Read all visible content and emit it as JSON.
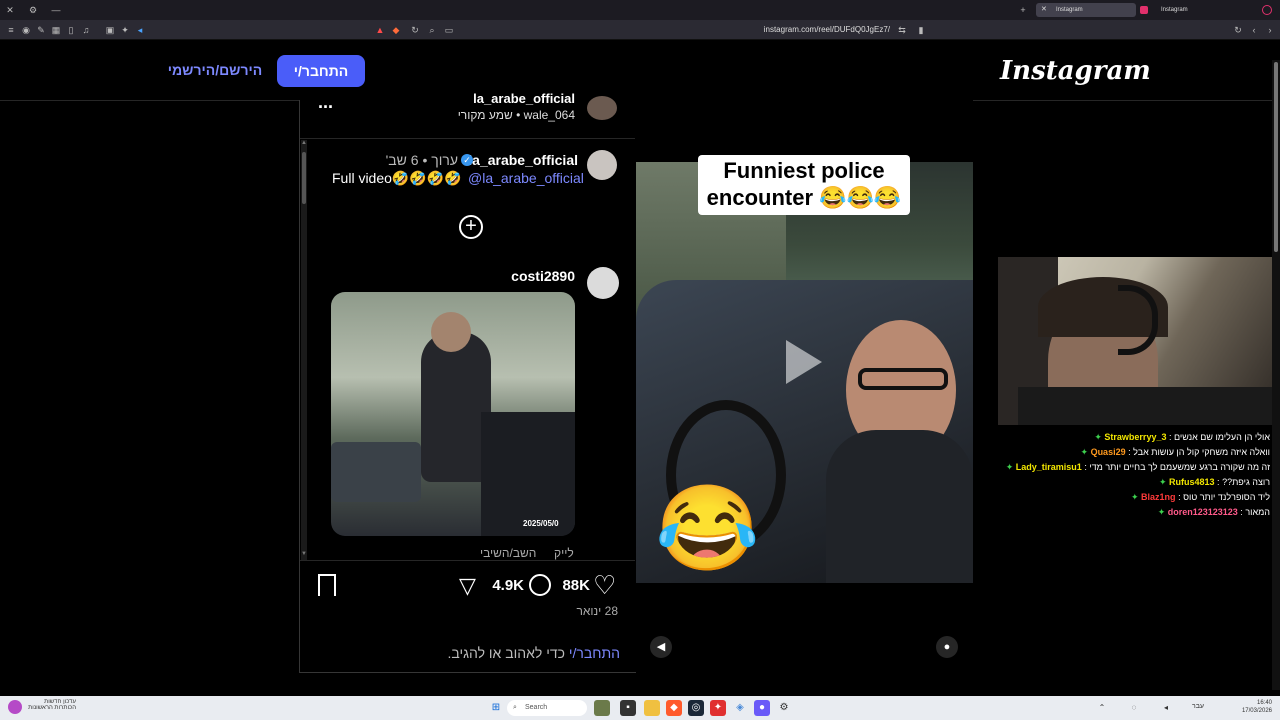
{
  "browser": {
    "url": "instagram.com/reel/DUFdQ0JgEz7/",
    "tabs": [
      {
        "title": "Instagram",
        "active": true
      },
      {
        "title": "Instagram",
        "active": false
      }
    ]
  },
  "header": {
    "logo": "Instagram",
    "login_button": "התחבר/י",
    "signup_link": "הירשם/הירשמי"
  },
  "post": {
    "top_user": "la_arabe_official",
    "top_user_sub": "wale_064 • שמע מקורי",
    "more_label": "...",
    "caption": {
      "username": "la_arabe_official",
      "meta": "ערוך • 6 שב'",
      "text": "Full video🤣🤣🤣🤣",
      "mention": "@la_arabe_official"
    },
    "comment": {
      "username": "costi2890",
      "like_label": "לייק",
      "reply_label": "השב/השיבי",
      "image_stamp": "2025/05/0"
    },
    "likes": "88K",
    "comments": "4.9K",
    "date": "28 ינואר",
    "login_prompt_link": "התחבר/י",
    "login_prompt_text": "כדי לאהוב או להגיב."
  },
  "video": {
    "overlay_caption_line1": "Funniest police",
    "overlay_caption_line2": "encounter 😂😂😂",
    "emoji": "😂"
  },
  "stream_chat": [
    {
      "user": "Strawberryy_3",
      "msg": "אולי הן העלימו שם אנשים",
      "color": "#f2e600"
    },
    {
      "user": "Quasi29",
      "msg": "וואלה איזה משחקי קול הן עושות אבל",
      "color": "#ff9a1f"
    },
    {
      "user": "Lady_tiramisu1",
      "msg": "זה מה שקורה ברגע שמשעמם לך בחיים יותר מדי",
      "color": "#f2e600"
    },
    {
      "user": "Rufus4813",
      "msg": "רוצה גיפת??",
      "color": "#f2e600"
    },
    {
      "user": "Blaz1ng",
      "msg": "ליד הסופרלנד יותר טוס",
      "color": "#ff3a3a"
    },
    {
      "user": "doren123123123",
      "msg": "המאור",
      "color": "#ff5a8a"
    }
  ],
  "taskbar": {
    "search_placeholder": "Search",
    "notif_title": "עדכון חדשות",
    "notif_sub": "הכותרות הראשונות",
    "clock_time": "16:40",
    "clock_date": "17/03/2026",
    "lang": "עבר"
  },
  "colors": {
    "accent": "#4a5df9",
    "link": "#7d89ff",
    "verified": "#3897f0"
  }
}
